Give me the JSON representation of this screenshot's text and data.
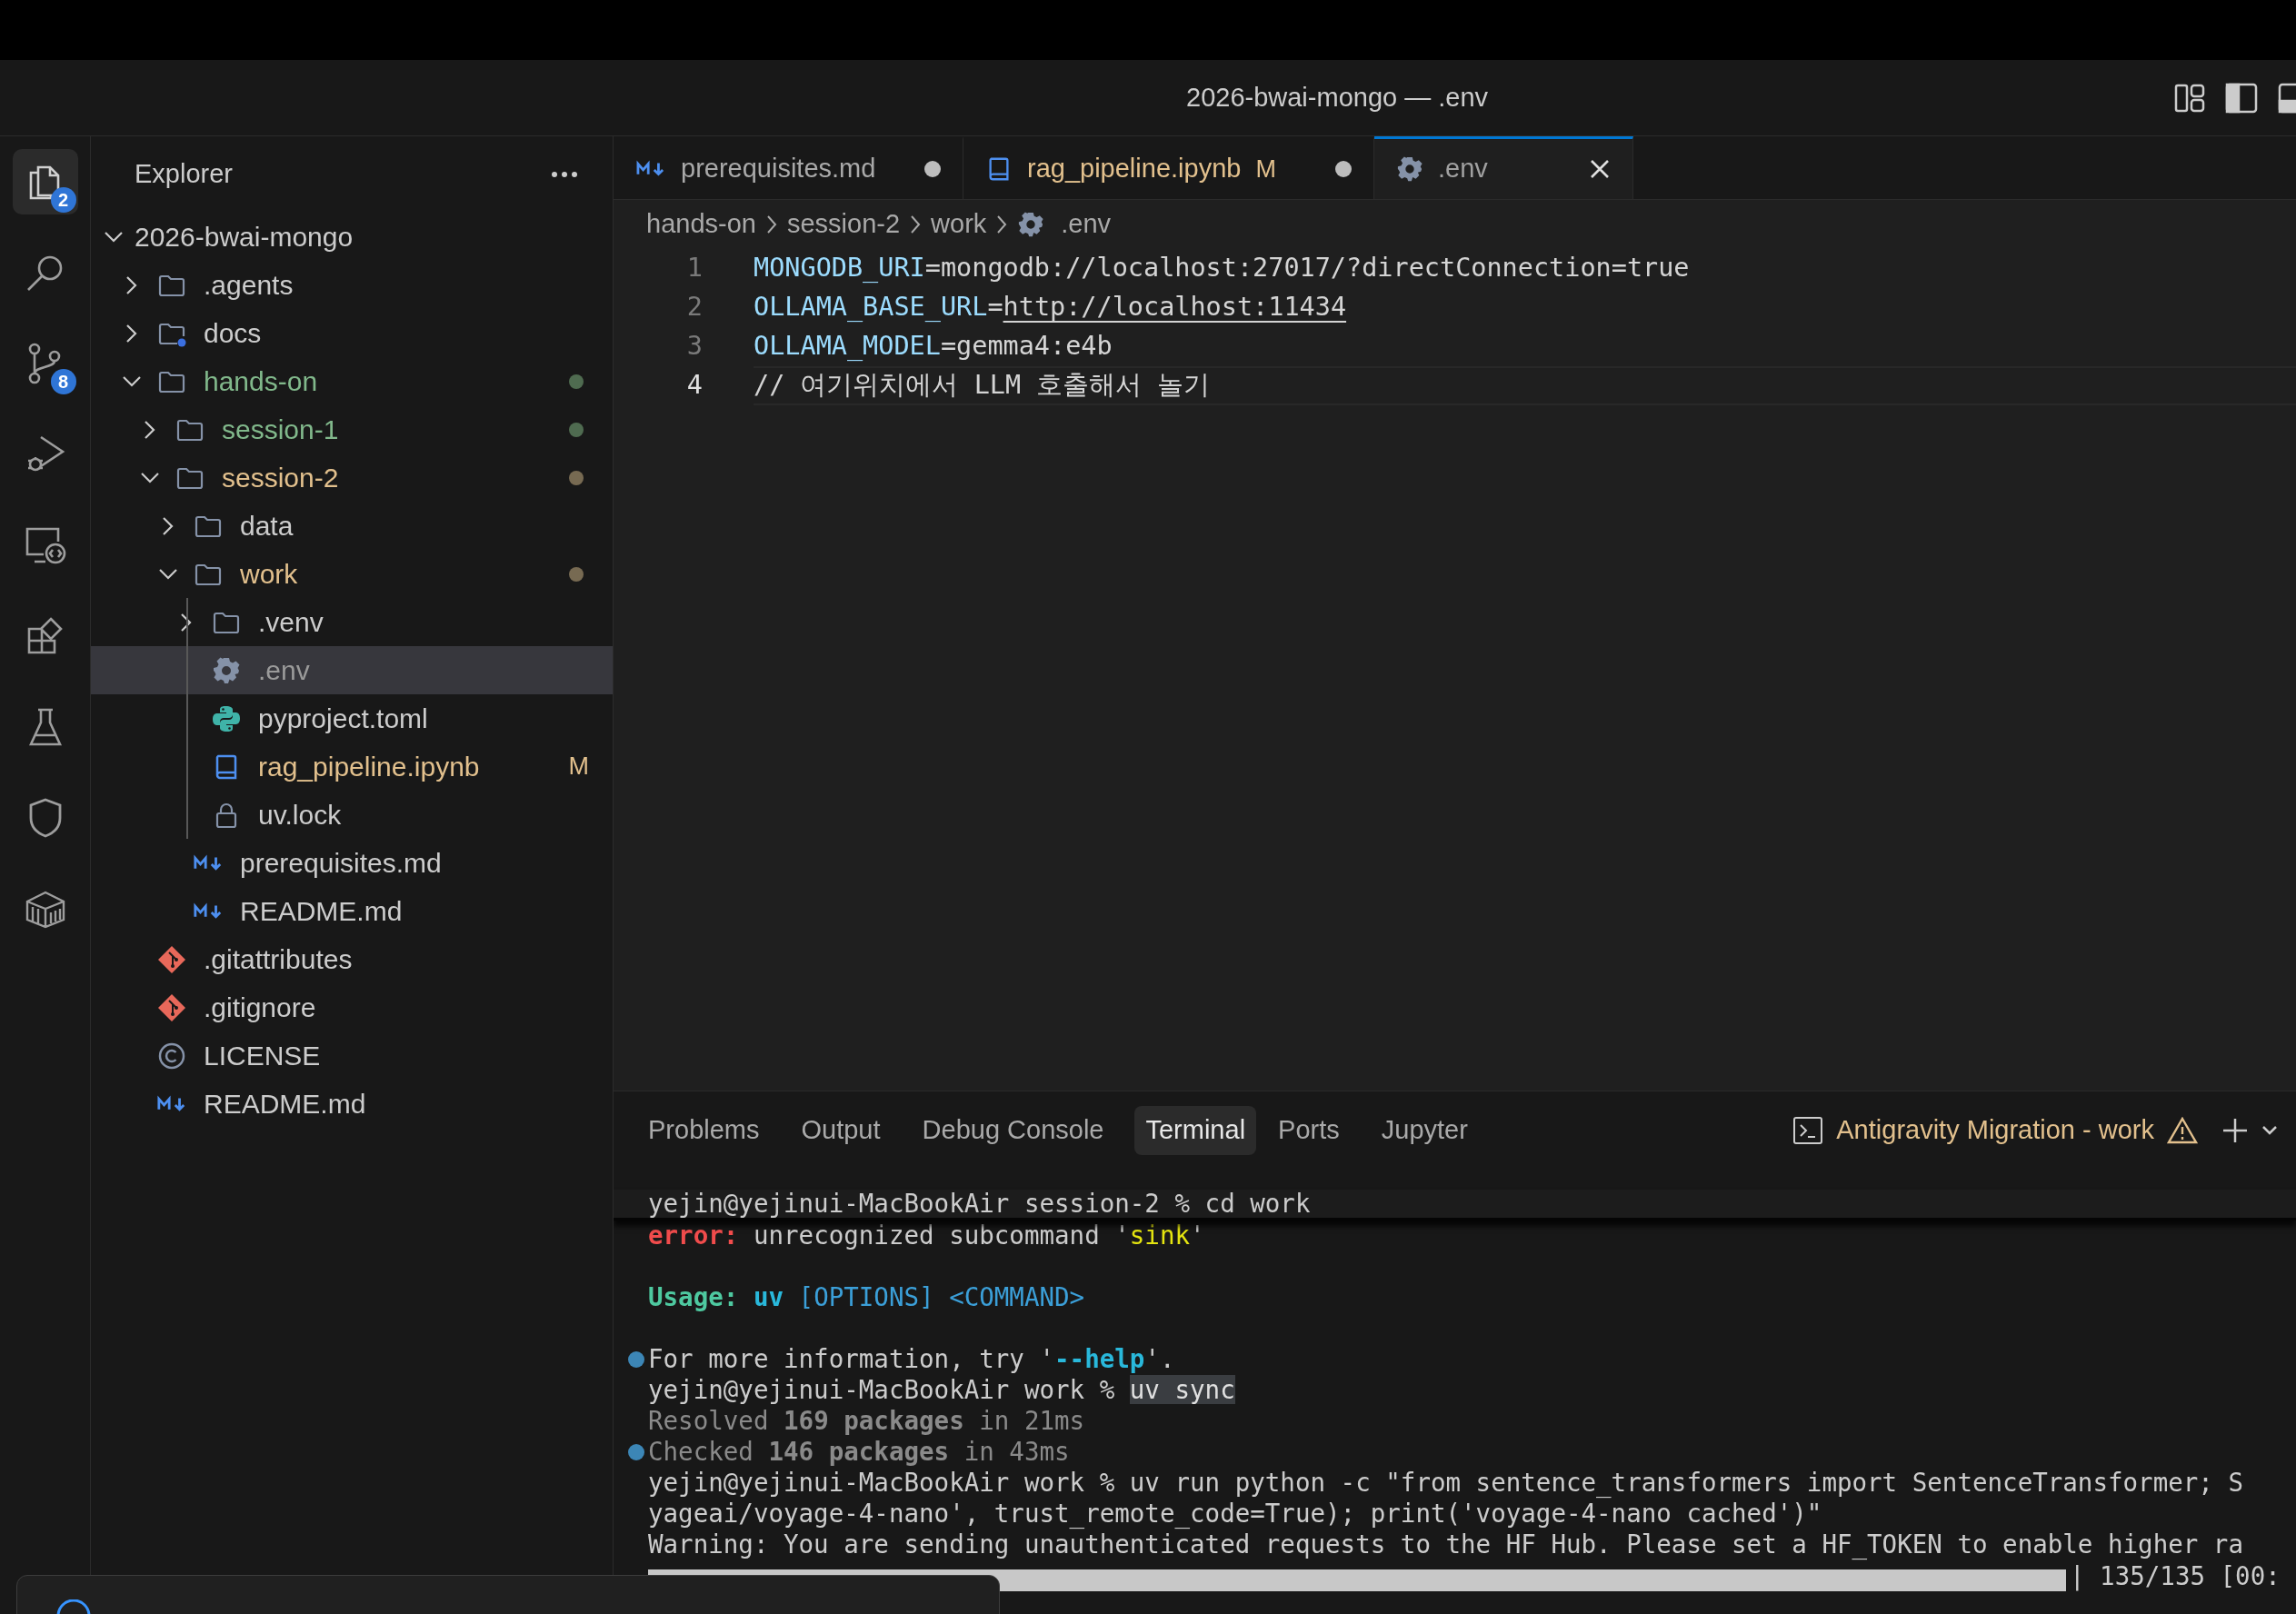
{
  "window": {
    "title": "2026-bwai-mongo — .env"
  },
  "activity_bar": [
    {
      "kind": "explorer",
      "selected": true,
      "badge": "2"
    },
    {
      "kind": "search",
      "selected": false
    },
    {
      "kind": "source-control",
      "selected": false,
      "badge": "8"
    },
    {
      "kind": "run",
      "selected": false
    },
    {
      "kind": "remote",
      "selected": false
    },
    {
      "kind": "extensions",
      "selected": false
    },
    {
      "kind": "testing",
      "selected": false
    },
    {
      "kind": "shield",
      "selected": false
    },
    {
      "kind": "box",
      "selected": false
    }
  ],
  "sidebar": {
    "title": "Explorer",
    "tree": {
      "label": "2026-bwai-mongo",
      "kind": "root",
      "expanded": true,
      "selected": false,
      "untracked": false,
      "modified": false,
      "children": [
        {
          "label": ".agents",
          "kind": "folder",
          "expanded": false,
          "selected": false,
          "untracked": false,
          "modified": false
        },
        {
          "label": "docs",
          "kind": "folder-docs",
          "expanded": false,
          "selected": false,
          "untracked": false,
          "modified": false
        },
        {
          "label": "hands-on",
          "kind": "folder",
          "expanded": true,
          "selected": false,
          "untracked": true,
          "modified": false,
          "children": [
            {
              "label": "session-1",
              "kind": "folder",
              "expanded": false,
              "selected": false,
              "untracked": true,
              "modified": false
            },
            {
              "label": "session-2",
              "kind": "folder",
              "expanded": true,
              "selected": false,
              "untracked": false,
              "modified": true,
              "children": [
                {
                  "label": "data",
                  "kind": "folder",
                  "expanded": false,
                  "selected": false,
                  "untracked": false,
                  "modified": false
                },
                {
                  "label": "work",
                  "kind": "folder",
                  "expanded": true,
                  "selected": false,
                  "untracked": false,
                  "modified": true,
                  "children": [
                    {
                      "label": ".venv",
                      "kind": "folder",
                      "expanded": false,
                      "selected": false,
                      "untracked": false,
                      "modified": false
                    },
                    {
                      "label": ".env",
                      "kind": "settings",
                      "selected": true,
                      "untracked": false,
                      "modified": false
                    },
                    {
                      "label": "pyproject.toml",
                      "kind": "python",
                      "selected": false,
                      "untracked": false,
                      "modified": false
                    },
                    {
                      "label": "rag_pipeline.ipynb",
                      "kind": "notebook",
                      "selected": false,
                      "untracked": false,
                      "modified": true,
                      "badge": "M"
                    },
                    {
                      "label": "uv.lock",
                      "kind": "lock",
                      "selected": false,
                      "untracked": false,
                      "modified": false
                    }
                  ]
                },
                {
                  "label": "prerequisites.md",
                  "kind": "markdown",
                  "selected": false,
                  "untracked": false,
                  "modified": false
                },
                {
                  "label": "README.md",
                  "kind": "markdown",
                  "selected": false,
                  "untracked": false,
                  "modified": false
                }
              ]
            }
          ]
        },
        {
          "label": ".gitattributes",
          "kind": "git",
          "selected": false,
          "untracked": false,
          "modified": false
        },
        {
          "label": ".gitignore",
          "kind": "git",
          "selected": false,
          "untracked": false,
          "modified": false
        },
        {
          "label": "LICENSE",
          "kind": "license",
          "selected": false,
          "untracked": false,
          "modified": false
        },
        {
          "label": "README.md",
          "kind": "markdown",
          "selected": false,
          "untracked": false,
          "modified": false
        }
      ]
    }
  },
  "tabs": [
    {
      "label": "prerequisites.md",
      "kind": "markdown",
      "selected": false,
      "dirty": true,
      "modified": false
    },
    {
      "label": "rag_pipeline.ipynb",
      "kind": "notebook",
      "selected": false,
      "dirty": true,
      "modified": true,
      "badge": "M"
    },
    {
      "label": ".env",
      "kind": "settings",
      "selected": true,
      "dirty": false,
      "modified": false
    }
  ],
  "breadcrumb": [
    {
      "label": "hands-on",
      "kind": "folder"
    },
    {
      "label": "session-2",
      "kind": "folder"
    },
    {
      "label": "work",
      "kind": "folder"
    },
    {
      "label": ".env",
      "kind": "settings"
    }
  ],
  "editor": {
    "lines": [
      {
        "number": "1",
        "current": false,
        "segments": [
          {
            "text": "MONGODB_URI",
            "kind": "key"
          },
          {
            "text": "=mongodb://localhost:27017/?directConnection=true",
            "kind": "plain"
          }
        ]
      },
      {
        "number": "2",
        "current": false,
        "segments": [
          {
            "text": "OLLAMA_BASE_URL",
            "kind": "key"
          },
          {
            "text": "=",
            "kind": "plain"
          },
          {
            "text": "http://localhost:11434",
            "kind": "link"
          }
        ]
      },
      {
        "number": "3",
        "current": false,
        "segments": [
          {
            "text": "OLLAMA_MODEL",
            "kind": "key"
          },
          {
            "text": "=gemma4:e4b",
            "kind": "plain"
          }
        ]
      },
      {
        "number": "4",
        "current": true,
        "segments": [
          {
            "text": "// 여기위치에서 LLM 호출해서 놀기",
            "kind": "plain"
          }
        ]
      }
    ]
  },
  "panel": {
    "tabs": [
      {
        "label": "Problems",
        "selected": false
      },
      {
        "label": "Output",
        "selected": false
      },
      {
        "label": "Debug Console",
        "selected": false
      },
      {
        "label": "Terminal",
        "selected": true
      },
      {
        "label": "Ports",
        "selected": false
      },
      {
        "label": "Jupyter",
        "selected": false
      }
    ],
    "terminal_name": {
      "label": "Antigravity Migration - work",
      "warning": true
    },
    "terminal": [
      {
        "kind": "text",
        "sticky": true,
        "mark": false,
        "runs": [
          {
            "text": "yejin@yejinui-MacBookAir session-2 % cd work",
            "kind": "plain"
          }
        ]
      },
      {
        "kind": "text",
        "sticky": false,
        "mark": false,
        "runs": [
          {
            "text": "error:",
            "kind": "error"
          },
          {
            "text": " unrecognized subcommand '",
            "kind": "plain"
          },
          {
            "text": "sink",
            "kind": "value"
          },
          {
            "text": "'",
            "kind": "plain"
          }
        ]
      },
      {
        "kind": "blank"
      },
      {
        "kind": "text",
        "sticky": false,
        "mark": false,
        "runs": [
          {
            "text": "Usage:",
            "kind": "heading"
          },
          {
            "text": " uv",
            "kind": "command"
          },
          {
            "text": " [OPTIONS] <COMMAND>",
            "kind": "option"
          }
        ]
      },
      {
        "kind": "blank"
      },
      {
        "kind": "text",
        "sticky": false,
        "mark": true,
        "runs": [
          {
            "text": "For more information, try '",
            "kind": "plain"
          },
          {
            "text": "--help",
            "kind": "command"
          },
          {
            "text": "'.",
            "kind": "plain"
          }
        ]
      },
      {
        "kind": "text",
        "sticky": false,
        "mark": false,
        "runs": [
          {
            "text": "yejin@yejinui-MacBookAir work % ",
            "kind": "plain"
          },
          {
            "text": "uv sync",
            "kind": "selection"
          }
        ]
      },
      {
        "kind": "text",
        "sticky": false,
        "mark": false,
        "runs": [
          {
            "text": "Resolved ",
            "kind": "dim"
          },
          {
            "text": "169 packages",
            "kind": "dim-bold"
          },
          {
            "text": " in 21ms",
            "kind": "dim"
          }
        ]
      },
      {
        "kind": "text",
        "sticky": false,
        "mark": true,
        "runs": [
          {
            "text": "Checked ",
            "kind": "dim"
          },
          {
            "text": "146 packages",
            "kind": "dim-bold"
          },
          {
            "text": " in 43ms",
            "kind": "dim"
          }
        ]
      },
      {
        "kind": "text",
        "sticky": false,
        "mark": false,
        "runs": [
          {
            "text": "yejin@yejinui-MacBookAir work % uv run python -c \"from sentence_transformers import SentenceTransformer; S",
            "kind": "plain"
          }
        ]
      },
      {
        "kind": "text",
        "sticky": false,
        "mark": false,
        "runs": [
          {
            "text": "yageai/voyage-4-nano', trust_remote_code=True); print('voyage-4-nano cached')\"",
            "kind": "plain"
          }
        ]
      },
      {
        "kind": "text",
        "sticky": false,
        "mark": false,
        "runs": [
          {
            "text": "Warning: You are sending unauthenticated requests to the HF Hub. Please set a HF_TOKEN to enable higher ra",
            "kind": "plain"
          }
        ]
      },
      {
        "kind": "progress",
        "level": 1,
        "text": "| 135/135 [00:"
      }
    ]
  }
}
